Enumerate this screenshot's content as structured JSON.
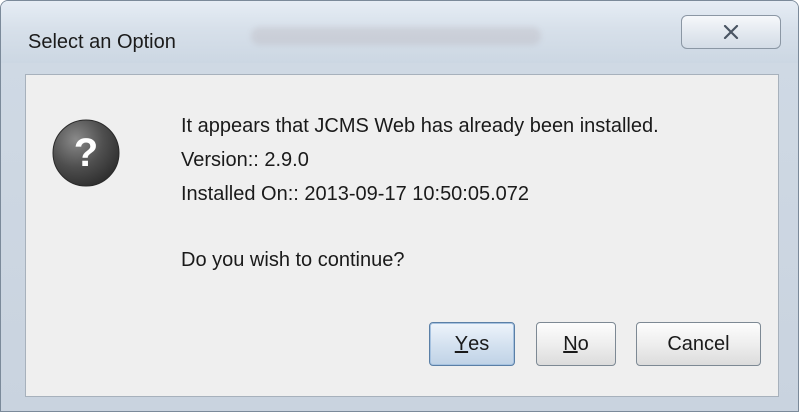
{
  "window": {
    "title": "Select an Option"
  },
  "message": {
    "line1": "It appears that JCMS Web has already been installed.",
    "line2": "Version:: 2.9.0",
    "line3": "Installed On:: 2013-09-17 10:50:05.072",
    "line4": "Do you wish to continue?"
  },
  "buttons": {
    "yes": {
      "mnemonic": "Y",
      "rest": "es"
    },
    "no": {
      "mnemonic": "N",
      "rest": "o"
    },
    "cancel": "Cancel"
  },
  "icons": {
    "dialog": "question-icon",
    "close": "close-icon"
  },
  "colors": {
    "icon_fill": "#4a4a4a",
    "default_button_border": "#5a7fa6"
  }
}
